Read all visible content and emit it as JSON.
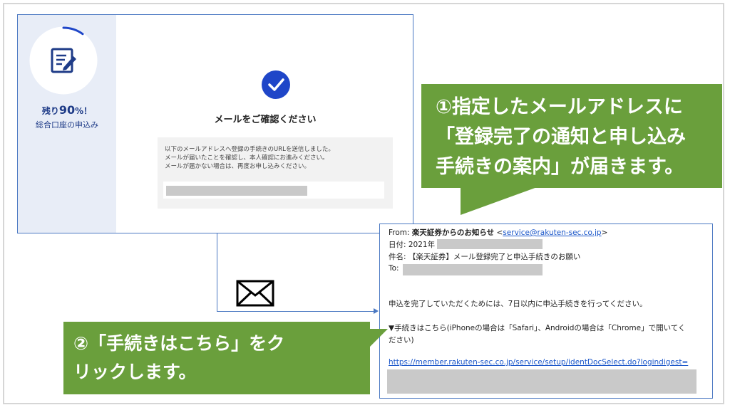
{
  "registration": {
    "progress_prefix": "残り",
    "progress_value": "90",
    "progress_suffix": "%！",
    "progress_fraction": 0.1,
    "sidebar_subtitle": "総合口座の申込み",
    "title": "メールをご確認ください",
    "body_lines": [
      "以下のメールアドレスへ登録の手続きのURLを送信しました。",
      "メールが届いたことを確認し、本人確認にお進みください。",
      "メールが届かない場合は、再度お申し込みください。"
    ]
  },
  "callouts": {
    "one": [
      "①指定したメールアドレスに",
      "「登録完了の通知と申し込み",
      "手続きの案内」が届きます。"
    ],
    "two": [
      "②「手続きはこちら」をク",
      "リックします。"
    ]
  },
  "email": {
    "from_label": "From: ",
    "from_name": "楽天証券からのお知らせ",
    "from_open": " <",
    "from_address": "service@rakuten-sec.co.jp",
    "from_close": ">",
    "date_label": "日付: 2021年",
    "subject": "件名: 【楽天証券】メール登録完了と申込手続きのお願い",
    "to_label": "To:",
    "body_line1": "申込を完了していただくためには、7日以内に申込手続きを行ってください。",
    "body_line2": "▼手続きはこちら(iPhoneの場合は「Safari」、Androidの場合は「Chrome」で開いてく",
    "body_line3": "ださい)",
    "link": "https://member.rakuten-sec.co.jp/service/setup/identDocSelect.do?logindigest="
  },
  "colors": {
    "accent_blue": "#1f46c8",
    "border_blue": "#4a78c2",
    "callout_green": "#6a9f3c",
    "sidebar_bg": "#e8edf7",
    "mask_gray": "#c9c9c9"
  }
}
